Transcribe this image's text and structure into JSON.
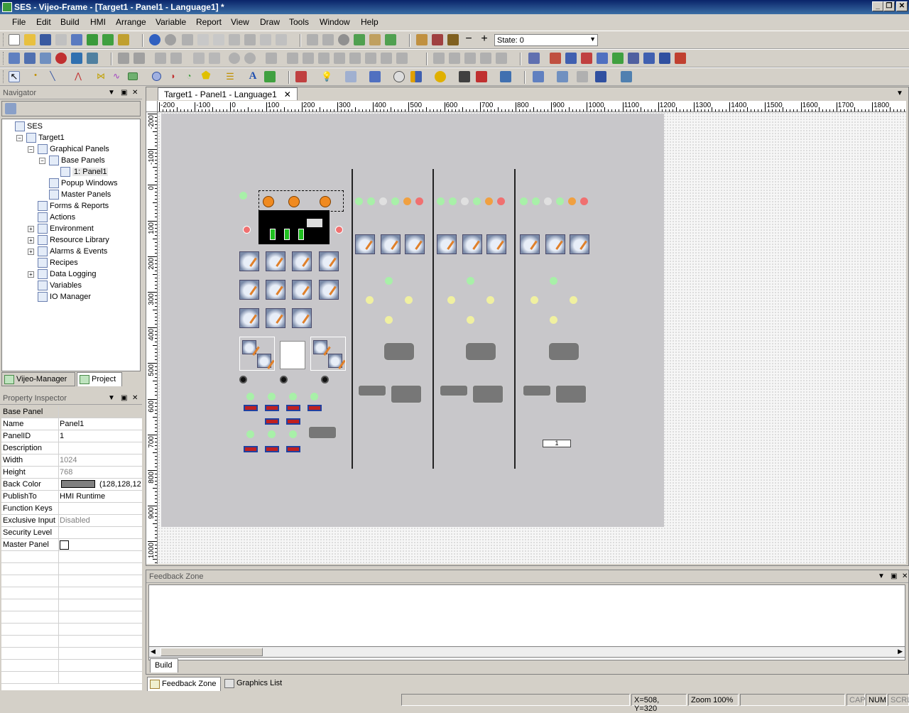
{
  "window": {
    "title": "SES - Vijeo-Frame - [Target1 - Panel1 - Language1] *"
  },
  "menu": [
    "File",
    "Edit",
    "Build",
    "HMI",
    "Arrange",
    "Variable",
    "Report",
    "View",
    "Draw",
    "Tools",
    "Window",
    "Help"
  ],
  "toolbar": {
    "state_label": "State: 0"
  },
  "navigator": {
    "title": "Navigator",
    "tree": [
      {
        "label": "SES",
        "level": 0,
        "exp": ""
      },
      {
        "label": "Target1",
        "level": 1,
        "exp": "-"
      },
      {
        "label": "Graphical Panels",
        "level": 2,
        "exp": "-"
      },
      {
        "label": "Base Panels",
        "level": 3,
        "exp": "-"
      },
      {
        "label": "1: Panel1",
        "level": 4,
        "exp": ""
      },
      {
        "label": "Popup Windows",
        "level": 3,
        "exp": ""
      },
      {
        "label": "Master Panels",
        "level": 3,
        "exp": ""
      },
      {
        "label": "Forms & Reports",
        "level": 2,
        "exp": ""
      },
      {
        "label": "Actions",
        "level": 2,
        "exp": ""
      },
      {
        "label": "Environment",
        "level": 2,
        "exp": "+"
      },
      {
        "label": "Resource Library",
        "level": 2,
        "exp": "+"
      },
      {
        "label": "Alarms & Events",
        "level": 2,
        "exp": "+"
      },
      {
        "label": "Recipes",
        "level": 2,
        "exp": ""
      },
      {
        "label": "Data Logging",
        "level": 2,
        "exp": "+"
      },
      {
        "label": "Variables",
        "level": 2,
        "exp": ""
      },
      {
        "label": "IO Manager",
        "level": 2,
        "exp": ""
      }
    ],
    "tabs": [
      "Vijeo-Manager",
      "Project"
    ]
  },
  "property_inspector": {
    "title": "Property Inspector",
    "header": "Base Panel",
    "rows": [
      {
        "k": "Name",
        "v": "Panel1",
        "dim": false
      },
      {
        "k": "PanelID",
        "v": "1",
        "dim": false
      },
      {
        "k": "Description",
        "v": "",
        "dim": false
      },
      {
        "k": "Width",
        "v": "1024",
        "dim": true
      },
      {
        "k": "Height",
        "v": "768",
        "dim": true
      },
      {
        "k": "Back Color",
        "v": "(128,128,12",
        "dim": false
      },
      {
        "k": "PublishTo",
        "v": "HMI Runtime",
        "dim": false
      },
      {
        "k": "Function Keys",
        "v": "",
        "dim": false
      },
      {
        "k": "Exclusive Input",
        "v": "Disabled",
        "dim": true
      },
      {
        "k": "Security Level",
        "v": "",
        "dim": true
      },
      {
        "k": "Master Panel",
        "v": "",
        "dim": false
      }
    ]
  },
  "document": {
    "tab": "Target1 - Panel1 - Language1",
    "ruler_h": [
      "-200",
      "-100",
      "0",
      "100",
      "200",
      "300",
      "400",
      "500",
      "600",
      "700",
      "800",
      "900",
      "1000",
      "1100",
      "1200",
      "1300",
      "1400",
      "1500",
      "1600",
      "1700",
      "1800"
    ],
    "ruler_v": [
      "-200",
      "-100",
      "0",
      "100",
      "200",
      "300",
      "400",
      "500",
      "600",
      "700",
      "800",
      "900",
      "1000"
    ],
    "panel_value": "1"
  },
  "feedback": {
    "title": "Feedback Zone",
    "tab": "Build"
  },
  "bottom_tabs": [
    "Feedback Zone",
    "Graphics List"
  ],
  "status": {
    "coords": "X=508, Y=320",
    "zoom": "Zoom 100%",
    "cap": "CAP",
    "num": "NUM",
    "scrl": "SCRL"
  }
}
